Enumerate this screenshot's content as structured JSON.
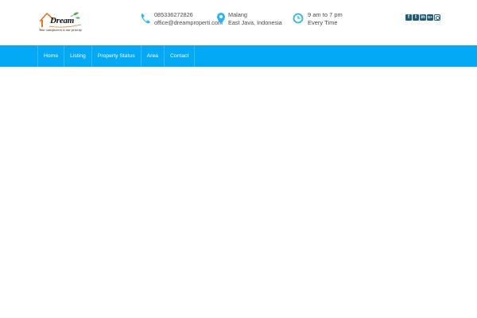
{
  "brand": {
    "logo_word": "Dream",
    "tagline": "Your satisfaction is our priority",
    "colors": {
      "roof": "#e07b1a",
      "leaf": "#4caf50"
    }
  },
  "contact": {
    "phone": {
      "icon": "phone-icon",
      "line1": "085336272826",
      "line2": "office@dreamproperti.com"
    },
    "location": {
      "icon": "map-pin-icon",
      "line1": "Malang",
      "line2": "East Java, Indonesia"
    },
    "hours": {
      "icon": "clock-icon",
      "line1": "9 am to 7 pm",
      "line2": "Every Time"
    }
  },
  "social": {
    "items": [
      {
        "icon": "facebook-icon",
        "glyph": "f"
      },
      {
        "icon": "twitter-icon",
        "glyph": "t"
      },
      {
        "icon": "linkedin-icon",
        "glyph": "in"
      },
      {
        "icon": "google-plus-icon",
        "glyph": "G+"
      },
      {
        "icon": "instagram-icon",
        "glyph": ""
      }
    ]
  },
  "nav": {
    "items": [
      {
        "label": "Home"
      },
      {
        "label": "Listing"
      },
      {
        "label": "Property Status"
      },
      {
        "label": "Area"
      },
      {
        "label": "Contact"
      }
    ]
  },
  "colors": {
    "accent": "#03a9f4",
    "icon": "#29b6f6",
    "social": "#1f5b7a"
  }
}
